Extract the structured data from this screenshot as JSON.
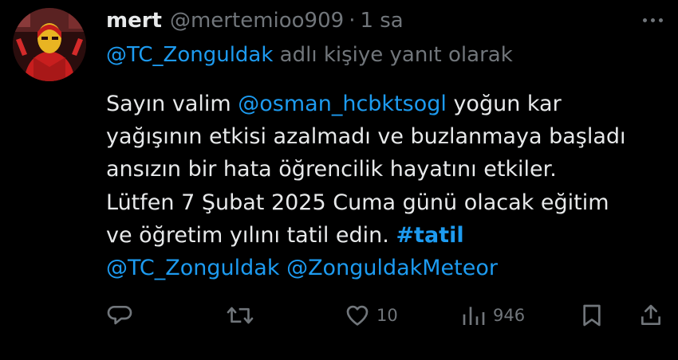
{
  "tweet": {
    "display_name": "mert",
    "handle": "@mertemioo909",
    "separator": "·",
    "time": "1 sa",
    "reply_to": {
      "mention": "@TC_Zonguldak",
      "suffix": " adlı kişiye yanıt olarak"
    },
    "text": {
      "l1_a": "Sayın valim ",
      "l1_mention": "@osman_hcbktsogl",
      "l1_b": " yoğun kar",
      "l2": "yağışının etkisi azalmadı ve buzlanmaya başladı",
      "l3": "ansızın bir hata öğrencilik hayatını etkiler.",
      "l4": "Lütfen 7 Şubat 2025 Cuma günü olacak eğitim",
      "l5_a": "ve öğretim yılını tatil edin. ",
      "l5_hashtag": "#tatil",
      "l6_m1": "@TC_Zonguldak",
      "l6_sep": " ",
      "l6_m2": "@ZonguldakMeteor"
    }
  },
  "actions": {
    "reply_icon": "reply-icon",
    "retweet_icon": "retweet-icon",
    "like_icon": "heart-icon",
    "like_count": "10",
    "views_icon": "views-icon",
    "views_count": "946",
    "bookmark_icon": "bookmark-icon",
    "share_icon": "share-icon"
  },
  "colors": {
    "background": "#000000",
    "text": "#e7e9ea",
    "muted": "#71767b",
    "link": "#1d9bf0"
  }
}
